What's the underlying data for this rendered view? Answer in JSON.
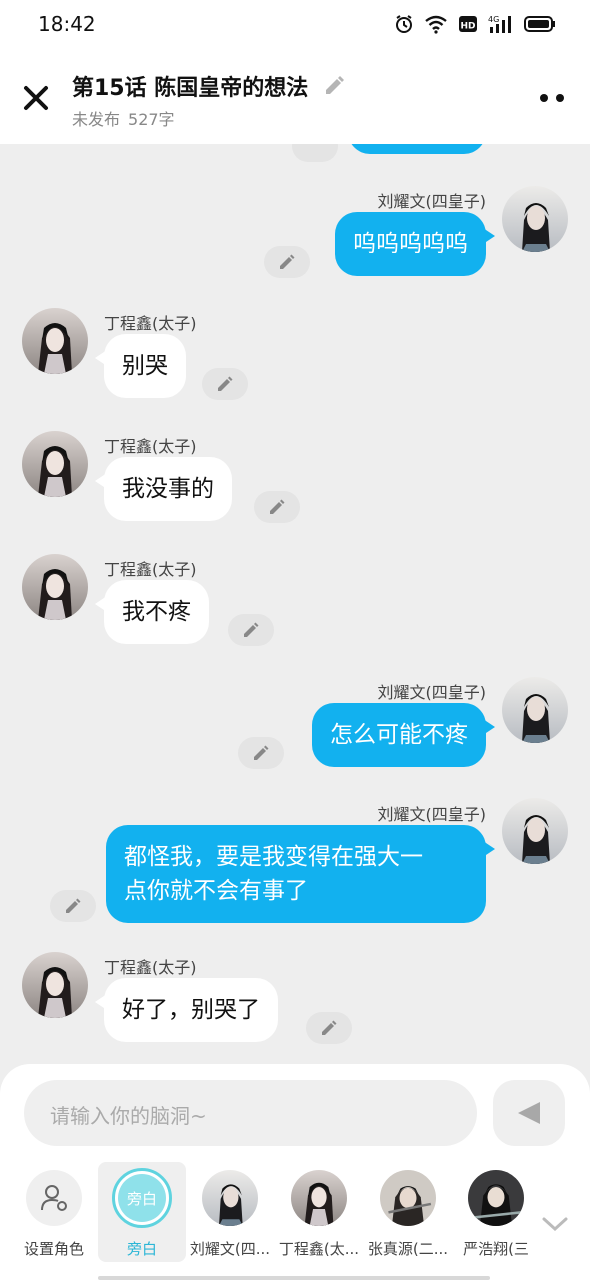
{
  "status": {
    "time": "18:42"
  },
  "header": {
    "title": "第15话  陈国皇帝的想法",
    "publish_state": "未发布",
    "word_count": "527字"
  },
  "messages": [
    {
      "side": "right",
      "speaker": "刘耀文(四皇子)",
      "text": "呜呜呜呜呜"
    },
    {
      "side": "left",
      "speaker": "丁程鑫(太子)",
      "text": "别哭"
    },
    {
      "side": "left",
      "speaker": "丁程鑫(太子)",
      "text": "我没事的"
    },
    {
      "side": "left",
      "speaker": "丁程鑫(太子)",
      "text": "我不疼"
    },
    {
      "side": "right",
      "speaker": "刘耀文(四皇子)",
      "text": "怎么可能不疼"
    },
    {
      "side": "right",
      "speaker": "刘耀文(四皇子)",
      "text_line1": "都怪我，要是我变得在强大一",
      "text_line2": "点你就不会有事了"
    },
    {
      "side": "left",
      "speaker": "丁程鑫(太子)",
      "text": "好了，别哭了"
    }
  ],
  "composer": {
    "placeholder": "请输入你的脑洞~"
  },
  "roles": [
    {
      "label": "设置角色",
      "icon": "person-gear-icon"
    },
    {
      "label": "旁白",
      "badge": "旁白",
      "selected": true
    },
    {
      "label": "刘耀文(四..."
    },
    {
      "label": "丁程鑫(太..."
    },
    {
      "label": "张真源(二..."
    },
    {
      "label": "严浩翔(三"
    }
  ],
  "colors": {
    "accent": "#12b1ef",
    "narrator": "#5fd3df"
  }
}
